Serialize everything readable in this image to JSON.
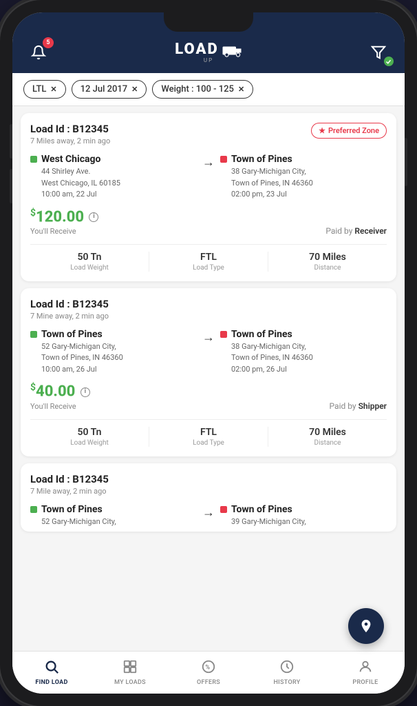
{
  "header": {
    "notif_count": "5",
    "logo_text": "LOAD",
    "logo_sub": "UP",
    "filter_icon": "🔽"
  },
  "filters": [
    {
      "label": "LTL"
    },
    {
      "label": "12 Jul 2017"
    },
    {
      "label": "Weight : 100 - 125"
    }
  ],
  "loads": [
    {
      "id": "Load Id : B12345",
      "meta": "7 Miles away, 2 min ago",
      "preferred": true,
      "preferred_label": "Preferred Zone",
      "origin_city": "West Chicago",
      "origin_addr": "44 Shirley Ave.\nWest Chicago, IL 60185\n10:00 am, 22 Jul",
      "dest_city": "Town of Pines",
      "dest_addr": "38 Gary-Michigan City,\nTown of Pines, IN 46360\n02:00 pm, 23 Jul",
      "price": "120.00",
      "price_label": "You'll Receive",
      "paid_by": "Receiver",
      "weight": "50 Tn",
      "weight_label": "Load Weight",
      "load_type": "FTL",
      "load_type_label": "Load Type",
      "distance": "70 Miles",
      "distance_label": "Distance"
    },
    {
      "id": "Load Id : B12345",
      "meta": "7 Mine away, 2 min ago",
      "preferred": false,
      "preferred_label": "",
      "origin_city": "Town of Pines",
      "origin_addr": "52 Gary-Michigan City,\nTown of Pines, IN 46360\n10:00 am, 26 Jul",
      "dest_city": "Town of Pines",
      "dest_addr": "38 Gary-Michigan City,\nTown of Pines, IN 46360\n02:00 pm, 26 Jul",
      "price": "40.00",
      "price_label": "You'll Receive",
      "paid_by": "Shipper",
      "weight": "50 Tn",
      "weight_label": "Load Weight",
      "load_type": "FTL",
      "load_type_label": "Load Type",
      "distance": "70 Miles",
      "distance_label": "Distance"
    },
    {
      "id": "Load Id : B12345",
      "meta": "7 Mile away, 2 min ago",
      "preferred": false,
      "preferred_label": "",
      "origin_city": "Town of Pines",
      "origin_addr": "52 Gary-Michigan City,\n39 Gary-Michigan City,",
      "dest_city": "Town of Pines",
      "dest_addr": "",
      "price": "",
      "price_label": "",
      "paid_by": "",
      "weight": "",
      "weight_label": "",
      "load_type": "",
      "load_type_label": "",
      "distance": "",
      "distance_label": ""
    }
  ],
  "nav": {
    "items": [
      {
        "label": "FIND LOAD",
        "active": true
      },
      {
        "label": "MY LOADS",
        "active": false
      },
      {
        "label": "OFFERS",
        "active": false
      },
      {
        "label": "HISTORY",
        "active": false
      },
      {
        "label": "PROFILE",
        "active": false
      }
    ]
  },
  "fab_icon": "📍"
}
